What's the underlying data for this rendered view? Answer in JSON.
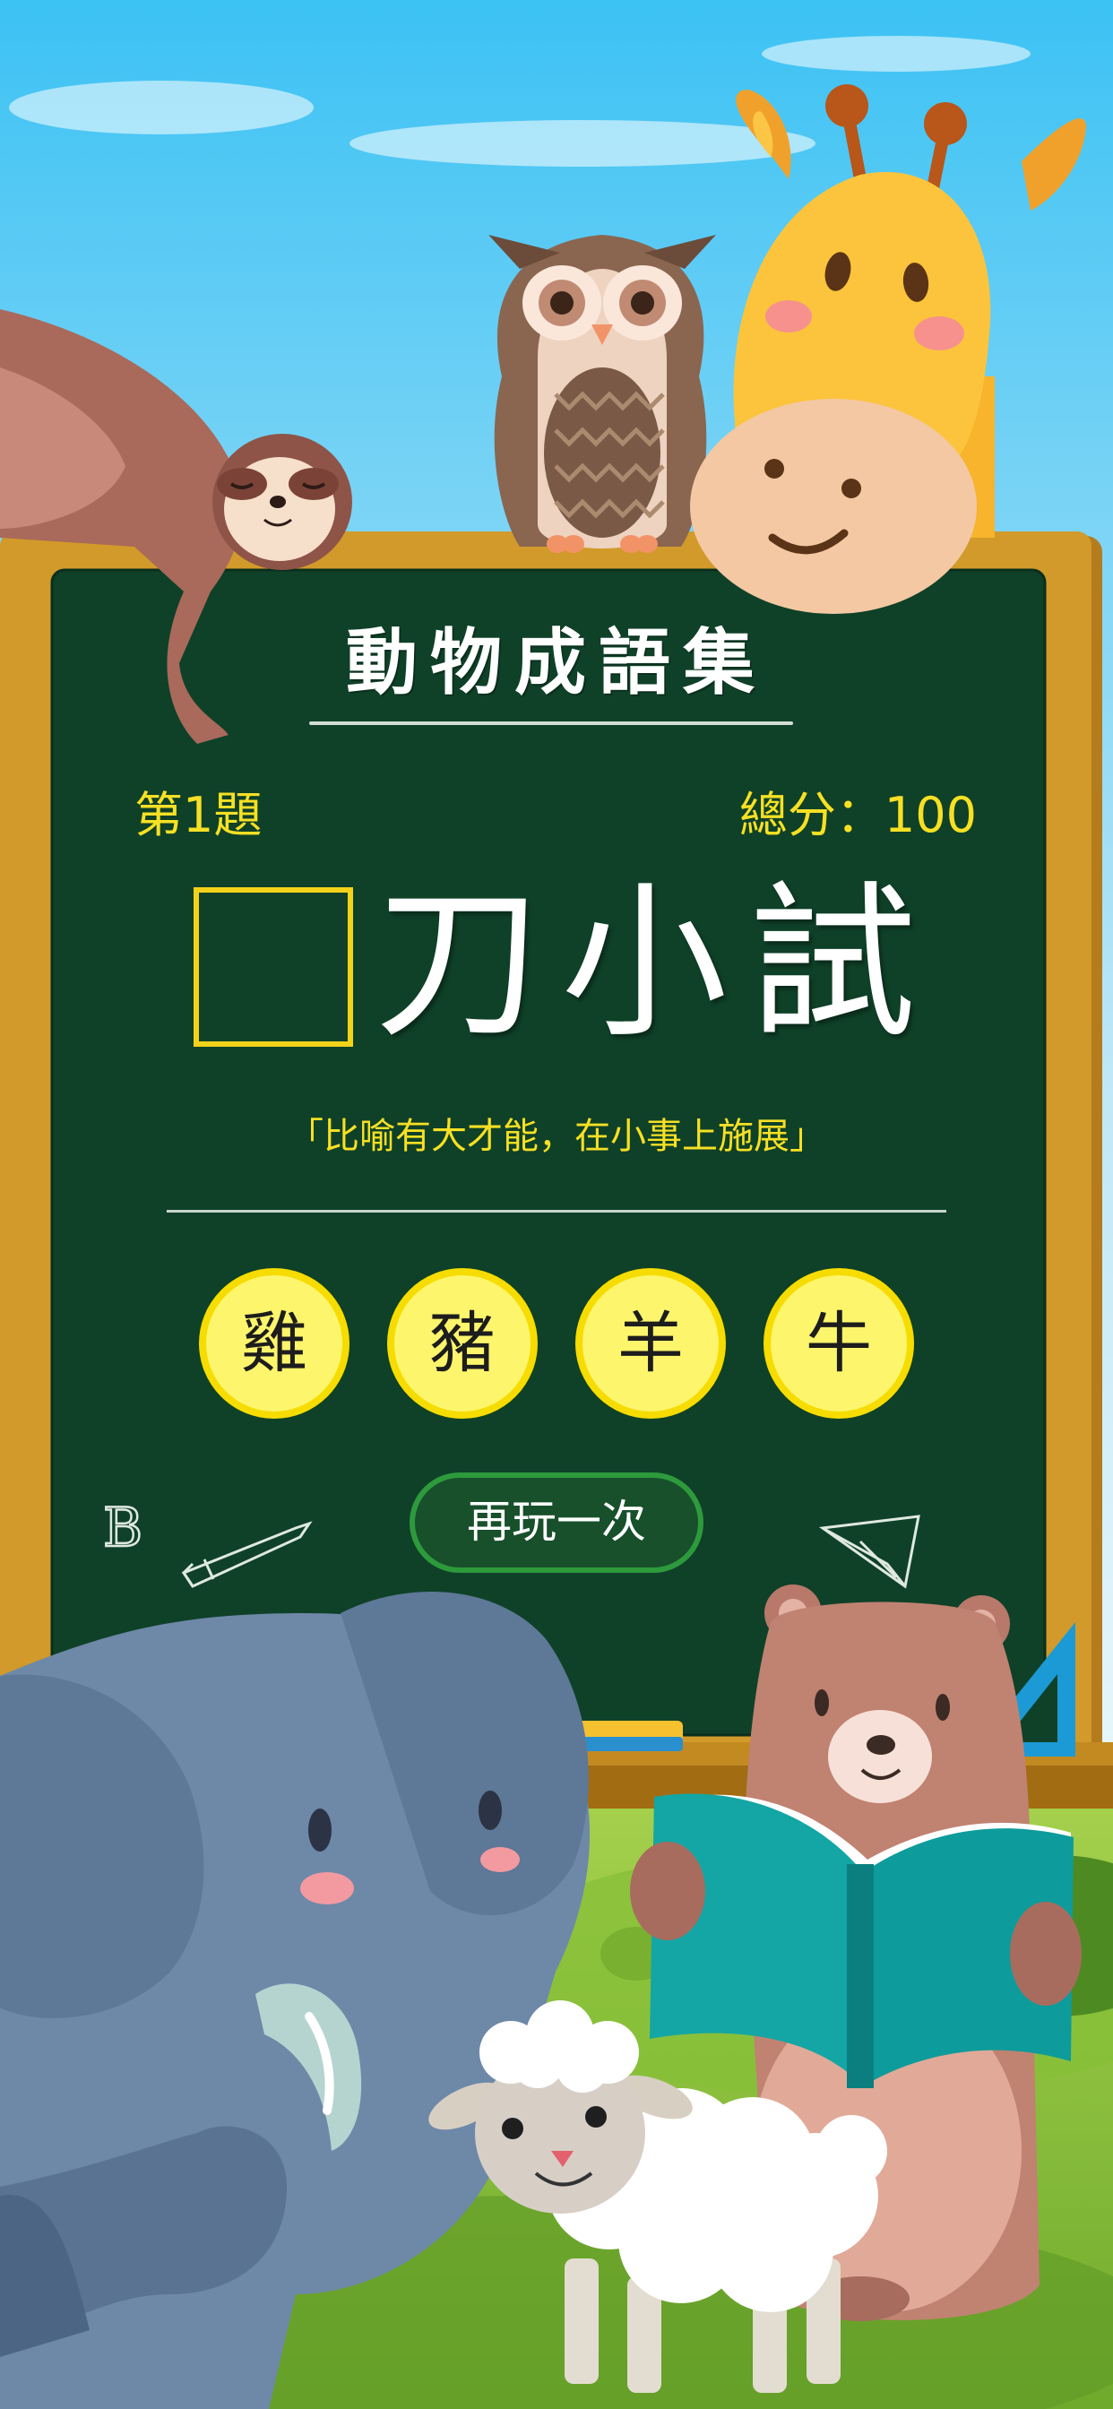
{
  "game": {
    "title": "動物成語集",
    "level_label": "第1題",
    "score_label": "總分：100",
    "idiom_visible_chars": [
      "刀",
      "小",
      "試"
    ],
    "hint": "「比喻有大才能，在小事上施展」",
    "options": [
      "雞",
      "豬",
      "羊",
      "牛"
    ],
    "replay_label": "再玩一次"
  },
  "decor": {
    "chalk_letter": "B"
  },
  "colors": {
    "sky_top": "#3cc2f4",
    "board_green": "#0f4128",
    "board_frame": "#d29a2b",
    "accent_yellow": "#f7e024",
    "option_fill": "#fdf56b",
    "replay_border": "#2d9a3c"
  },
  "icons": [
    "sloth",
    "owl",
    "giraffe",
    "elephant",
    "bear",
    "sheep",
    "book",
    "pencil-icon",
    "paper-plane-icon",
    "ruler-icon",
    "eraser-icon"
  ]
}
